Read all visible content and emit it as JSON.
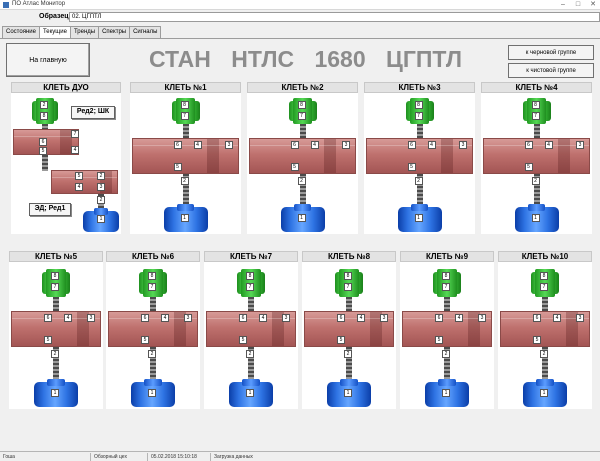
{
  "window": {
    "title": "ПО Атлас Монитор",
    "controls": [
      "–",
      "□",
      "✕"
    ]
  },
  "sample": {
    "label": "Образец",
    "value": "02. ЦГПТЛ"
  },
  "tabs": [
    "Состояние",
    "Текущие",
    "Тренды",
    "Спектры",
    "Сигналы"
  ],
  "active_tab": "Текущие",
  "header": {
    "home_button": "На главную",
    "title": "СТАН НТЛС 1680 ЦГПТЛ",
    "rough_group_button": "к черновой группе",
    "finish_group_button": "к чистовой группе"
  },
  "duo": {
    "title": "КЛЕТЬ ДУО",
    "reducer_button": "Ред2; ШК",
    "motor_button": "ЭД; Ред1",
    "gear_tags": [
      "2",
      "8"
    ],
    "box1_tags": [
      "7",
      "6",
      "5",
      "4"
    ],
    "box2_tags": [
      "5",
      "4",
      "2",
      "3"
    ],
    "shaft_tag": "2",
    "motor_tag": "1"
  },
  "stands": [
    {
      "title": "КЛЕТЬ №1",
      "tags": [
        "8",
        "7",
        "6",
        "4",
        "3",
        "5",
        "2",
        "1"
      ]
    },
    {
      "title": "КЛЕТЬ №2",
      "tags": [
        "8",
        "7",
        "6",
        "4",
        "3",
        "5",
        "2",
        "1"
      ]
    },
    {
      "title": "КЛЕТЬ №3",
      "tags": [
        "8",
        "7",
        "6",
        "4",
        "3",
        "5",
        "2",
        "1"
      ]
    },
    {
      "title": "КЛЕТЬ №4",
      "tags": [
        "8",
        "7",
        "6",
        "4",
        "3",
        "5",
        "2",
        "1"
      ]
    },
    {
      "title": "КЛЕТЬ №5",
      "tags": [
        "8",
        "7",
        "6",
        "4",
        "3",
        "5",
        "2",
        "1"
      ]
    },
    {
      "title": "КЛЕТЬ №6",
      "tags": [
        "8",
        "7",
        "6",
        "4",
        "3",
        "5",
        "2",
        "1"
      ]
    },
    {
      "title": "КЛЕТЬ №7",
      "tags": [
        "8",
        "7",
        "6",
        "4",
        "3",
        "5",
        "2",
        "1"
      ]
    },
    {
      "title": "КЛЕТЬ №8",
      "tags": [
        "8",
        "7",
        "6",
        "4",
        "3",
        "5",
        "2",
        "1"
      ]
    },
    {
      "title": "КЛЕТЬ №9",
      "tags": [
        "8",
        "7",
        "6",
        "4",
        "3",
        "5",
        "2",
        "1"
      ]
    },
    {
      "title": "КЛЕТЬ №10",
      "tags": [
        "8",
        "7",
        "6",
        "4",
        "3",
        "5",
        "2",
        "1"
      ]
    }
  ],
  "status": {
    "user": "Гоша",
    "view": "Обзорный цех",
    "datetime": "05.02.2018 15:10:18",
    "message": "Загрузка данных"
  },
  "colors": {
    "gear": "#3fc23f",
    "gearbox": "#bf716e",
    "motor": "#2e73e3",
    "title_grey": "#8c8c8c"
  }
}
